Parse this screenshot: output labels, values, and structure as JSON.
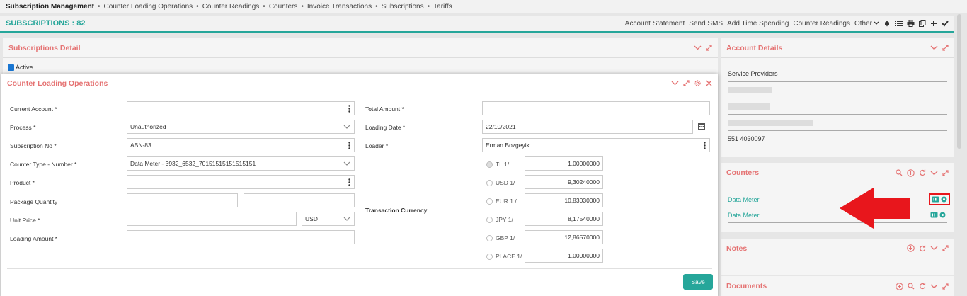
{
  "nav": {
    "items": [
      "Subscription Management",
      "Counter Loading Operations",
      "Counter Readings",
      "Counters",
      "Invoice Transactions",
      "Subscriptions",
      "Tariffs"
    ],
    "separator": "•"
  },
  "subbar": {
    "title": "SUBSCRIPTIONS : 82",
    "actions": [
      "Account Statement",
      "Send SMS",
      "Add Time Spending",
      "Counter Readings",
      "Other"
    ]
  },
  "subscriptions_detail": {
    "title": "Subscriptions Detail",
    "active_label": "Active"
  },
  "account_details": {
    "title": "Account Details",
    "service_providers": "Service Providers",
    "phone": "551 4030097"
  },
  "counters_panel": {
    "title": "Counters",
    "items": [
      "Data Meter",
      "Data Meter"
    ]
  },
  "notes_panel": {
    "title": "Notes"
  },
  "documents_panel": {
    "title": "Documents"
  },
  "modal": {
    "title": "Counter Loading Operations",
    "labels": {
      "current_account": "Current Account *",
      "process": "Process *",
      "subscription_no": "Subscription No *",
      "counter_type": "Counter Type - Number *",
      "product": "Product *",
      "package_quantity": "Package Quantity",
      "unit_price": "Unit Price *",
      "loading_amount": "Loading Amount *",
      "total_amount": "Total Amount *",
      "loading_date": "Loading Date *",
      "loader": "Loader *",
      "transaction_currency": "Transaction Currency"
    },
    "values": {
      "process": "Unauthorized",
      "subscription_no": "ABN-83",
      "counter_type": "Data Meter - 3932_6532_70151515151515151",
      "unit_currency": "USD",
      "loading_date": "22/10/2021",
      "loader": "Erman Bozgeyik"
    },
    "currencies": [
      {
        "label": "TL 1/",
        "value": "1,00000000"
      },
      {
        "label": "USD 1/",
        "value": "9,30240000"
      },
      {
        "label": "EUR 1 /",
        "value": "10,83030000"
      },
      {
        "label": "JPY 1/",
        "value": "8,17540000"
      },
      {
        "label": "GBP 1/",
        "value": "12,86570000"
      },
      {
        "label": "PLACE 1/",
        "value": "1,00000000"
      }
    ],
    "save_label": "Save"
  },
  "colors": {
    "accent": "#26a69a",
    "title_red": "#e57373",
    "arrow_red": "#e8161c"
  }
}
